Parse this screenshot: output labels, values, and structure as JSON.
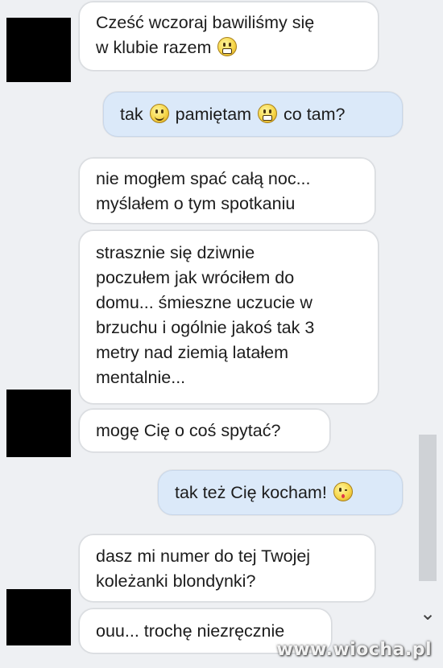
{
  "conversation": {
    "messages": [
      {
        "from": "them",
        "lines": [
          "Cześć wczoraj bawiliśmy się",
          "w klubie razem"
        ],
        "emoticons": [
          "grin"
        ]
      },
      {
        "from": "me",
        "parts": [
          "tak",
          "pamiętam",
          "co tam?"
        ],
        "emoticons": [
          "smile",
          "grin"
        ]
      },
      {
        "from": "them",
        "lines": [
          "nie mogłem spać całą noc...",
          "myślałem o tym spotkaniu"
        ]
      },
      {
        "from": "them",
        "lines": [
          "strasznie się dziwnie",
          "poczułem jak wróciłem do",
          "domu... śmieszne uczucie w",
          "brzuchu i ogólnie jakoś tak 3",
          "metry nad ziemią latałem",
          "mentalnie..."
        ]
      },
      {
        "from": "them",
        "lines": [
          "mogę Cię o coś spytać?"
        ]
      },
      {
        "from": "me",
        "lines": [
          "tak też Cię kocham!"
        ],
        "emoticons": [
          "kiss"
        ]
      },
      {
        "from": "them",
        "lines": [
          "dasz mi numer do tej Twojej",
          "koleżanki blondynki?"
        ]
      },
      {
        "from": "them",
        "lines": [
          "ouu... trochę niezręcznie"
        ]
      }
    ]
  },
  "watermark": "www.wiocha.pl",
  "colors": {
    "incoming_bg": "#ffffff",
    "outgoing_bg": "#dbe9f9",
    "page_bg": "#eef0f3"
  },
  "icons": {
    "scroll_down": "chevron-down-icon",
    "avatar": "redacted-avatar"
  }
}
